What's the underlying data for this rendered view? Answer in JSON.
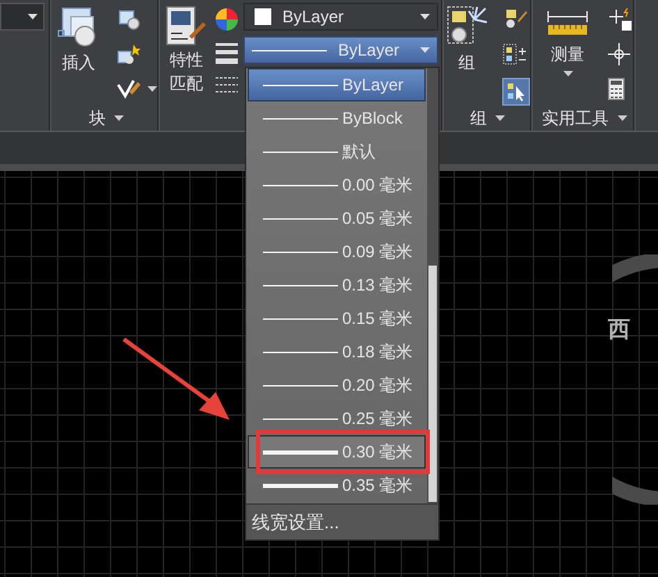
{
  "ribbon": {
    "block_panel": {
      "title": "块",
      "insert_button": "插入"
    },
    "properties_panel": {
      "match_button": [
        "特性",
        "匹配"
      ],
      "color_combo": "ByLayer",
      "lineweight_combo": {
        "value": "ByLayer",
        "expanded": true
      }
    },
    "group_panel": {
      "title": "组",
      "group_button": "组",
      "select_toggle": {
        "on": true
      }
    },
    "utilities_panel": {
      "title": "实用工具",
      "measure_button": "测量"
    }
  },
  "lineweight_dropdown": {
    "items": [
      {
        "label": "ByLayer",
        "kind": "thin",
        "selected": true,
        "hovered": false
      },
      {
        "label": "ByBlock",
        "kind": "thin",
        "selected": false,
        "hovered": false
      },
      {
        "label": "默认",
        "kind": "thin",
        "selected": false,
        "hovered": false
      },
      {
        "label": "0.00 毫米",
        "kind": "thin",
        "selected": false,
        "hovered": false
      },
      {
        "label": "0.05 毫米",
        "kind": "thin",
        "selected": false,
        "hovered": false
      },
      {
        "label": "0.09 毫米",
        "kind": "thin",
        "selected": false,
        "hovered": false
      },
      {
        "label": "0.13 毫米",
        "kind": "thin",
        "selected": false,
        "hovered": false
      },
      {
        "label": "0.15 毫米",
        "kind": "thin",
        "selected": false,
        "hovered": false
      },
      {
        "label": "0.18 毫米",
        "kind": "thin",
        "selected": false,
        "hovered": false
      },
      {
        "label": "0.20 毫米",
        "kind": "thin",
        "selected": false,
        "hovered": false
      },
      {
        "label": "0.25 毫米",
        "kind": "thin",
        "selected": false,
        "hovered": false
      },
      {
        "label": "0.30 毫米",
        "kind": "thick",
        "selected": false,
        "hovered": true
      },
      {
        "label": "0.35 毫米",
        "kind": "thick",
        "selected": false,
        "hovered": false
      }
    ],
    "footer": "线宽设置..."
  },
  "canvas": {
    "compass_label": "西"
  }
}
